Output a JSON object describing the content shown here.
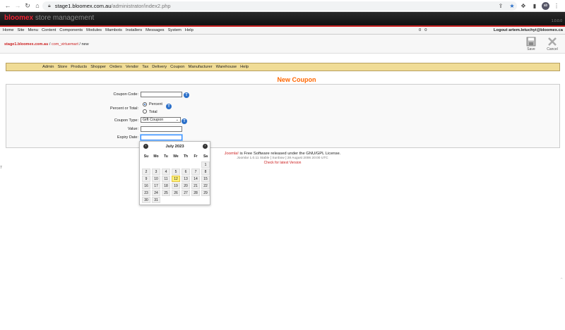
{
  "browser": {
    "url_host": "stage1.bloomex.com.au",
    "url_path": "/administrator/index2.php",
    "profile_initials": "ab"
  },
  "header": {
    "brand_red": "bloomex",
    "brand_grey": "store management",
    "version": "1.0.0.0"
  },
  "topmenu": {
    "items": [
      "Home",
      "Site",
      "Menu",
      "Content",
      "Components",
      "Modules",
      "Mambots",
      "Installers",
      "Messages",
      "System",
      "Help"
    ],
    "count_a": "0",
    "count_b": "0",
    "logout": "Logout artem.letuchyi@bloomex.ca"
  },
  "pathway": {
    "site": "stage1.bloomex.com.au",
    "sep1": " / ",
    "component": "com_virtuemart",
    "sep2": " / ",
    "current": "new"
  },
  "toolbar": {
    "save_label": "Save",
    "cancel_label": "Cancel"
  },
  "submenu": {
    "items": [
      "Admin",
      "Store",
      "Products",
      "Shopper",
      "Orders",
      "Vendor",
      "Tax",
      "Delivery",
      "Coupon",
      "Manufacturer",
      "Warehouse",
      "Help"
    ]
  },
  "page_title": "New Coupon",
  "form": {
    "coupon_code_label": "Coupon Code:",
    "coupon_code_value": "",
    "percent_total_label": "Percent or Total:",
    "percent_option": "Percent",
    "total_option": "Total",
    "coupon_type_label": "Coupon Type:",
    "coupon_type_value": "Gift Coupon",
    "value_label": "Value:",
    "value_value": "",
    "expiry_label": "Expiry Date:",
    "expiry_value": "",
    "help_glyph": "T"
  },
  "calendar": {
    "title": "July 2023",
    "prev_glyph": "‹",
    "next_glyph": "›",
    "days_of_week": [
      "Su",
      "Mo",
      "Tu",
      "We",
      "Th",
      "Fr",
      "Sa"
    ],
    "weeks": [
      [
        "",
        "",
        "",
        "",
        "",
        "",
        "1"
      ],
      [
        "2",
        "3",
        "4",
        "5",
        "6",
        "7",
        "8"
      ],
      [
        "9",
        "10",
        "11",
        "12",
        "13",
        "14",
        "15"
      ],
      [
        "16",
        "17",
        "18",
        "19",
        "20",
        "21",
        "22"
      ],
      [
        "23",
        "24",
        "25",
        "26",
        "27",
        "28",
        "29"
      ],
      [
        "30",
        "31",
        "",
        "",
        "",
        "",
        ""
      ]
    ],
    "today": "12",
    "today_color": "#fff27a"
  },
  "footer": {
    "joomla": "Joomla!",
    "license": " is Free Software released under the GNU/GPL License.",
    "version_line": "Joomla! 1.0.11 Stable [ Sunbow ] 28 August 2006 20:00 UTC",
    "check_link": "Check for latest Version"
  },
  "stray_mark": "7",
  "colors": {
    "accent_red": "#cc2222",
    "title_orange": "#ff6600",
    "submenu_bg": "#f0dc96",
    "help_blue": "#2a6fc9"
  }
}
